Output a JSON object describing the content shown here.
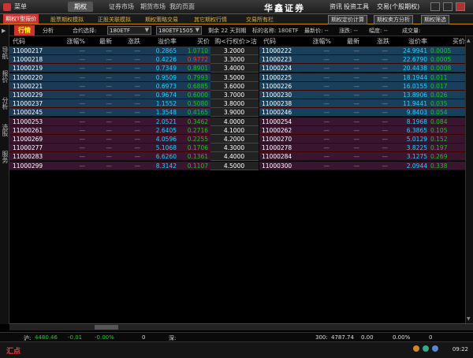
{
  "title": {
    "menu": "菜单",
    "tabs": [
      "期权",
      "证券市场",
      "期货市场",
      "我的页面"
    ],
    "brand": "华鑫证券",
    "right_menu": [
      "资讯",
      "投资工具",
      "交易(个股期权)"
    ]
  },
  "subnav": {
    "items": [
      "期权T型报价",
      "股票期权模拟",
      "正股关联模拟",
      "期权策略交易",
      "其它期权行情",
      "交易所有栏"
    ],
    "right_items": [
      "期权定价计算",
      "期权卖方分析",
      "期权筛选"
    ]
  },
  "sidebar": [
    "导航",
    "报价",
    "分析",
    "选股",
    "服务"
  ],
  "filter": {
    "tab_active": "行情",
    "tab_other": "分析",
    "contract_label": "合约选择:",
    "contract_value": "180ETF",
    "month_value": "180ETF1505",
    "remaining": "剩余 22 天到期",
    "underlying": "标的名称: 180ETF",
    "latest_label": "最新价: --",
    "change_label": "涨跌: --",
    "amp_label": "幅度: --",
    "vol_label": "成交量:"
  },
  "headers_left": [
    "代码",
    "涨幅%",
    "最新",
    "涨跌",
    "溢价率",
    "买价"
  ],
  "header_strike": "购<行权价>沽",
  "headers_right": [
    "代码",
    "涨幅%",
    "最新",
    "涨跌",
    "溢价率",
    "买价"
  ],
  "rows": [
    {
      "lc": "11000217",
      "lp": "0.2865",
      "lb": "1.0710",
      "k": "3.2000",
      "rc": "11000222",
      "rp": "24.9941",
      "rb": "0.0005",
      "lbc": "#20c020",
      "lcolor": "blue"
    },
    {
      "lc": "11000218",
      "lp": "0.4226",
      "lb": "0.9772",
      "k": "3.3000",
      "rc": "11000223",
      "rp": "22.6790",
      "rb": "0.0005",
      "lbc": "#ff3030",
      "lcolor": "blue"
    },
    {
      "lc": "11000219",
      "lp": "0.7349",
      "lb": "0.8901",
      "k": "3.4000",
      "rc": "11000224",
      "rp": "20.4438",
      "rb": "0.0008",
      "lbc": "#20c020",
      "lcolor": "blue"
    },
    {
      "lc": "11000220",
      "lp": "0.9509",
      "lb": "0.7993",
      "k": "3.5000",
      "rc": "11000225",
      "rp": "18.1944",
      "rb": "0.011",
      "lbc": "#20c020",
      "lcolor": "blue"
    },
    {
      "lc": "11000221",
      "lp": "0.6973",
      "lb": "0.6885",
      "k": "3.6000",
      "rc": "11000226",
      "rp": "16.0155",
      "rb": "0.017",
      "lbc": "#20c020",
      "lcolor": "blue"
    },
    {
      "lc": "11000229",
      "lp": "0.9674",
      "lb": "0.6000",
      "k": "3.7000",
      "rc": "11000230",
      "rp": "13.8906",
      "rb": "0.026",
      "lbc": "#20c020",
      "lcolor": "blue"
    },
    {
      "lc": "11000237",
      "lp": "1.1552",
      "lb": "0.5080",
      "k": "3.8000",
      "rc": "11000238",
      "rp": "11.9441",
      "rb": "0.035",
      "lbc": "#20c020",
      "lcolor": "blue"
    },
    {
      "lc": "11000245",
      "lp": "1.3548",
      "lb": "0.4165",
      "k": "3.9000",
      "rc": "11000246",
      "rp": "9.8403",
      "rb": "0.054",
      "lbc": "#20c020",
      "lcolor": "blue"
    },
    {
      "lc": "11000253",
      "lp": "2.0521",
      "lb": "0.3462",
      "k": "4.0000",
      "rc": "11000254",
      "rp": "8.1968",
      "rb": "0.084",
      "lbc": "#20c020",
      "lcolor": "dark"
    },
    {
      "lc": "11000261",
      "lp": "2.6405",
      "lb": "0.2716",
      "k": "4.1000",
      "rc": "11000262",
      "rp": "6.3865",
      "rb": "0.105",
      "lbc": "#20c020",
      "lcolor": "dark"
    },
    {
      "lc": "11000269",
      "lp": "4.0596",
      "lb": "0.2255",
      "k": "4.2000",
      "rc": "11000270",
      "rp": "5.0129",
      "rb": "0.152",
      "lbc": "#20c020",
      "lcolor": "dark"
    },
    {
      "lc": "11000277",
      "lp": "5.1068",
      "lb": "0.1706",
      "k": "4.3000",
      "rc": "11000278",
      "rp": "3.8225",
      "rb": "0.197",
      "lbc": "#20c020",
      "lcolor": "dark"
    },
    {
      "lc": "11000283",
      "lp": "6.6260",
      "lb": "0.1361",
      "k": "4.4000",
      "rc": "11000284",
      "rp": "3.1275",
      "rb": "0.269",
      "lbc": "#20c020",
      "lcolor": "dark"
    },
    {
      "lc": "11000299",
      "lp": "8.3142",
      "lb": "0.1107",
      "k": "4.5000",
      "rc": "11000300",
      "rp": "2.0944",
      "rb": "0.338",
      "lbc": "#20c020",
      "lcolor": "dark"
    }
  ],
  "dash": "—",
  "status": {
    "sh_label": "沪:",
    "sh_val": "4480.46",
    "sh_chg": "-0.01",
    "sh_pct": "-0.00%",
    "zero": "0",
    "sz_label": "深:",
    "idx300_label": "300:",
    "idx300_val": "4787.74",
    "idx300_chg": "0.00",
    "idx300_pct": "0.00%",
    "right_val": "0"
  },
  "bottom": {
    "hz": "汇点",
    "time": "09:22"
  },
  "colors": {
    "up_row_left": "#1a3a55",
    "down_row_left": "#3a1530",
    "up_row_right": "#18405a",
    "down_row_right": "#3a1530",
    "premium_cyan": "#20d0ff",
    "accent_red": "#cc3333"
  }
}
